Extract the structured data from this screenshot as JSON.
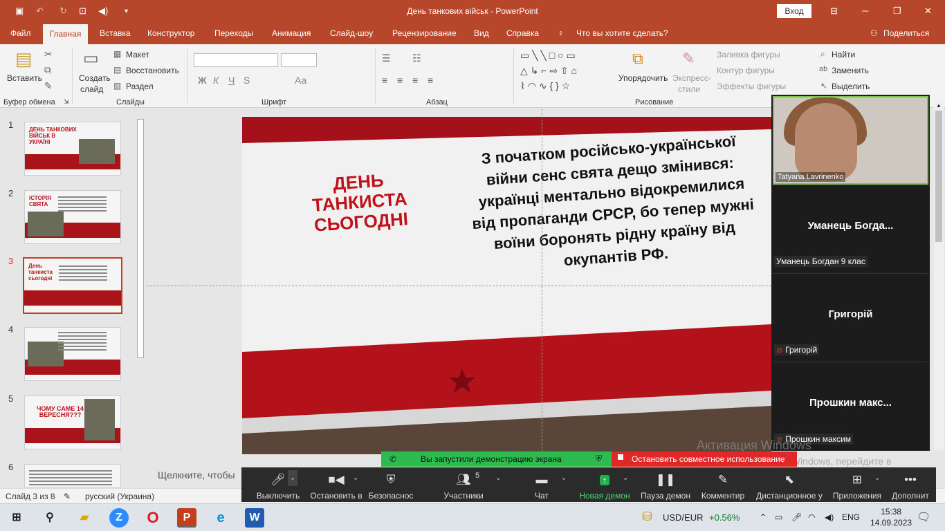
{
  "title_bar": {
    "title": "День танкових військ  -  PowerPoint",
    "sign_in": "Вход"
  },
  "menu": {
    "tabs": [
      "Файл",
      "Главная",
      "Вставка",
      "Конструктор",
      "Переходы",
      "Анимация",
      "Слайд-шоу",
      "Рецензирование",
      "Вид",
      "Справка"
    ],
    "tell_me": "Что вы хотите сделать?",
    "share": "Поделиться"
  },
  "ribbon": {
    "clipboard": {
      "paste": "Вставить",
      "group": "Буфер обмена"
    },
    "slides": {
      "new_slide_1": "Создать",
      "new_slide_2": "слайд",
      "layout": "Макет",
      "reset": "Восстановить",
      "section": "Раздел",
      "group": "Слайды"
    },
    "font": {
      "bold": "Ж",
      "italic": "К",
      "underline": "Ч",
      "strike": "S",
      "case": "Аа",
      "group": "Шрифт"
    },
    "paragraph": {
      "group": "Абзац"
    },
    "drawing": {
      "arrange_1": "Упорядочить",
      "quick_1": "Экспресс-",
      "quick_2": "стили",
      "fill": "Заливка фигуры",
      "outline": "Контур фигуры",
      "effects": "Эффекты фигуры",
      "group": "Рисование"
    },
    "editing": {
      "find": "Найти",
      "replace": "Заменить",
      "select": "Выделить"
    }
  },
  "thumbnails": [
    {
      "num": "1",
      "text": "ДЕНЬ ТАНКОВИХ ВІЙСЬК В УКРАЇНІ"
    },
    {
      "num": "2",
      "text": "ІСТОРІЯ СВЯТА"
    },
    {
      "num": "3",
      "text": "День танкиста сьогодні"
    },
    {
      "num": "4",
      "text": ""
    },
    {
      "num": "5",
      "text": "ЧОМУ САМЕ 14 ВЕРЕСНЯ???"
    },
    {
      "num": "6",
      "text": ""
    }
  ],
  "slide": {
    "title_1": "ДЕНЬ ТАНКИСТА",
    "title_2": "СЬОГОДНІ",
    "body": "З початком російсько-української війни сенс свята дещо змінився: українці ментально відокремилися від пропаганди СРСР, бо тепер мужні воїни боронять рідну країну від окупантів РФ."
  },
  "notes_placeholder": "Щелкните, чтобы",
  "status": {
    "slide_info": "Слайд 3 из 8",
    "language": "русский (Украина)"
  },
  "zoom_panel": {
    "video_name": "Tatyana Lavrinenko",
    "participants": [
      {
        "big": "Уманець  Богда...",
        "small": "Уманець Богдан 9 клас",
        "muted": false
      },
      {
        "big": "Григорій",
        "small": "Григорій",
        "muted": true
      },
      {
        "big": "Прошкин  макс...",
        "small": "Прошкин максим",
        "muted": true
      }
    ]
  },
  "share_bar": {
    "started": "Вы запустили демонстрацию экрана",
    "stop": "Остановить совместное использование"
  },
  "zoom_toolbar": {
    "mute": "Выключить",
    "video": "Остановить в",
    "security": "Безопаснос",
    "participants": "Участники",
    "participant_count": "5",
    "chat": "Чат",
    "new_share": "Новая демон",
    "pause": "Пауза демон",
    "annotate": "Комментир",
    "remote": "Дистанционное у",
    "apps": "Приложения",
    "more": "Дополнит"
  },
  "watermark": {
    "line1": "Активация Windows",
    "line2": "Чтобы активировать Windows, перейдите в раздел \"Параметры\"."
  },
  "taskbar": {
    "currency": "USD/EUR",
    "change": "+0.56%",
    "lang": "ENG",
    "time": "15:38",
    "date": "14.09.2023"
  },
  "colors": {
    "accent": "#b7472a",
    "slide_red": "#c0121a",
    "zoom_green": "#2dbb4f",
    "zoom_red": "#e02828"
  }
}
